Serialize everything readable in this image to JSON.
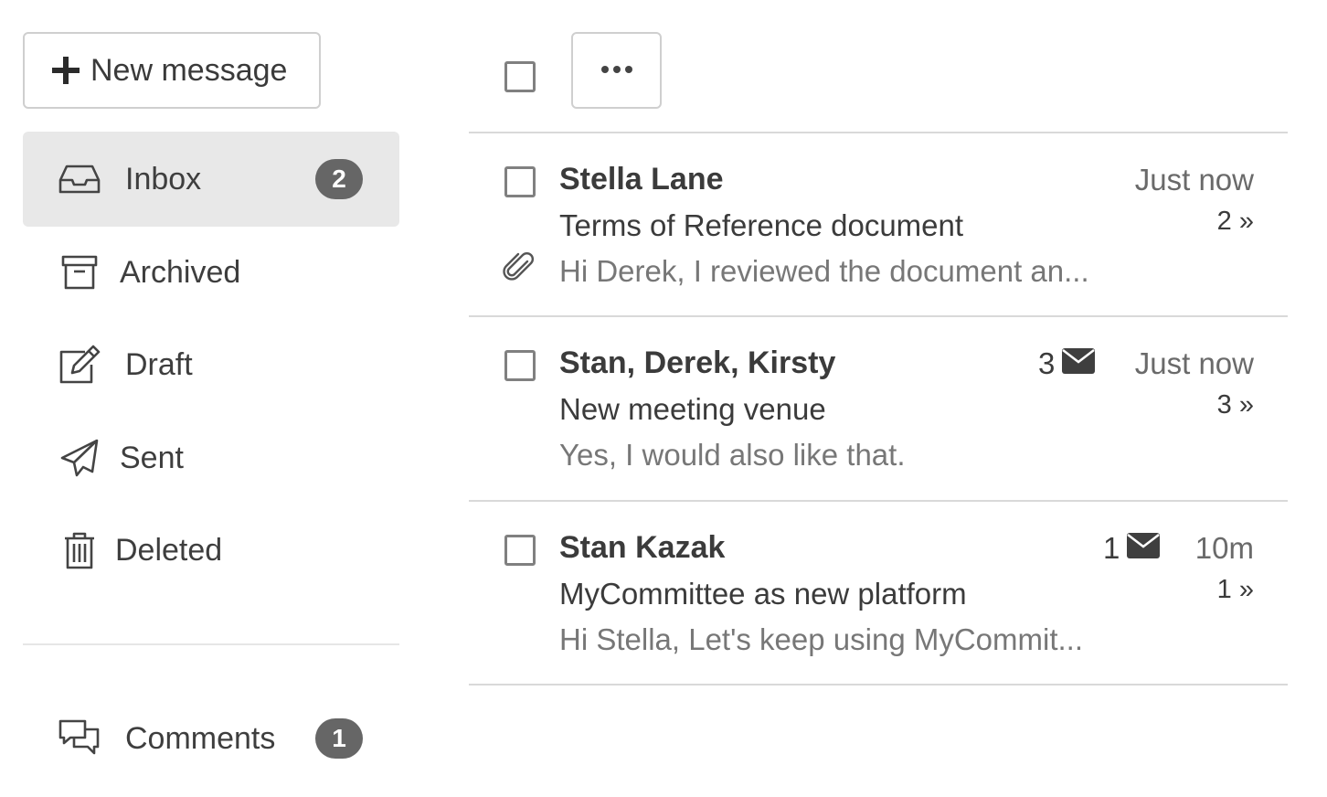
{
  "sidebar": {
    "new_message_label": "New message",
    "items": [
      {
        "label": "Inbox",
        "icon": "inbox-icon",
        "badge": "2",
        "active": true
      },
      {
        "label": "Archived",
        "icon": "archive-icon"
      },
      {
        "label": "Draft",
        "icon": "edit-icon"
      },
      {
        "label": "Sent",
        "icon": "send-icon"
      },
      {
        "label": "Deleted",
        "icon": "trash-icon"
      }
    ],
    "comments": {
      "label": "Comments",
      "icon": "comments-icon",
      "badge": "1"
    }
  },
  "toolbar": {
    "more_icon": "ellipsis-icon"
  },
  "messages": [
    {
      "sender": "Stella Lane",
      "subject": "Terms of Reference document",
      "preview": "Hi Derek, I reviewed the document an...",
      "time": "Just now",
      "thread": "2 »",
      "has_attachment": true
    },
    {
      "sender": "Stan, Derek, Kirsty",
      "subject": "New meeting venue",
      "preview": "Yes, I would also like that.",
      "time": "Just now",
      "thread": "3 »",
      "unread_count": "3"
    },
    {
      "sender": "Stan Kazak",
      "subject": "MyCommittee as new platform",
      "preview": "Hi Stella, Let's keep using MyCommit...",
      "time": "10m",
      "thread": "1 »",
      "unread_count": "1"
    }
  ],
  "colors": {
    "active_bg": "#e8e8e8",
    "badge_bg": "#666666",
    "border": "#cfcfcf",
    "text": "#3b3b3b",
    "muted": "#777777"
  }
}
